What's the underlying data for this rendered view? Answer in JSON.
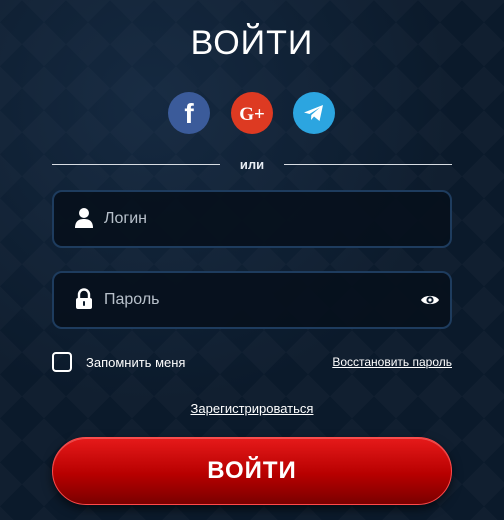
{
  "header": {
    "title": "ВОЙТИ"
  },
  "social": [
    {
      "icon": "facebook-icon",
      "label": "f",
      "color": "#3b5b9a"
    },
    {
      "icon": "google-plus-icon",
      "label": "G+",
      "color": "#dd3a22"
    },
    {
      "icon": "telegram-icon",
      "label": "",
      "color": "#2ca5e0"
    }
  ],
  "divider": {
    "text": "или"
  },
  "form": {
    "login": {
      "placeholder": "Логин",
      "value": "",
      "icon": "user-icon"
    },
    "password": {
      "placeholder": "Пароль",
      "value": "",
      "icon": "lock-icon",
      "toggle_icon": "eye-icon"
    },
    "remember_label": "Запомнить меня",
    "remember_checked": false,
    "restore_label": "Восстановить пароль",
    "register_label": "Зарегистрироваться",
    "submit_label": "ВОЙТИ"
  },
  "colors": {
    "background": "#0b1a2b",
    "accent": "#c80000",
    "field_border": "#1e3c5e"
  }
}
